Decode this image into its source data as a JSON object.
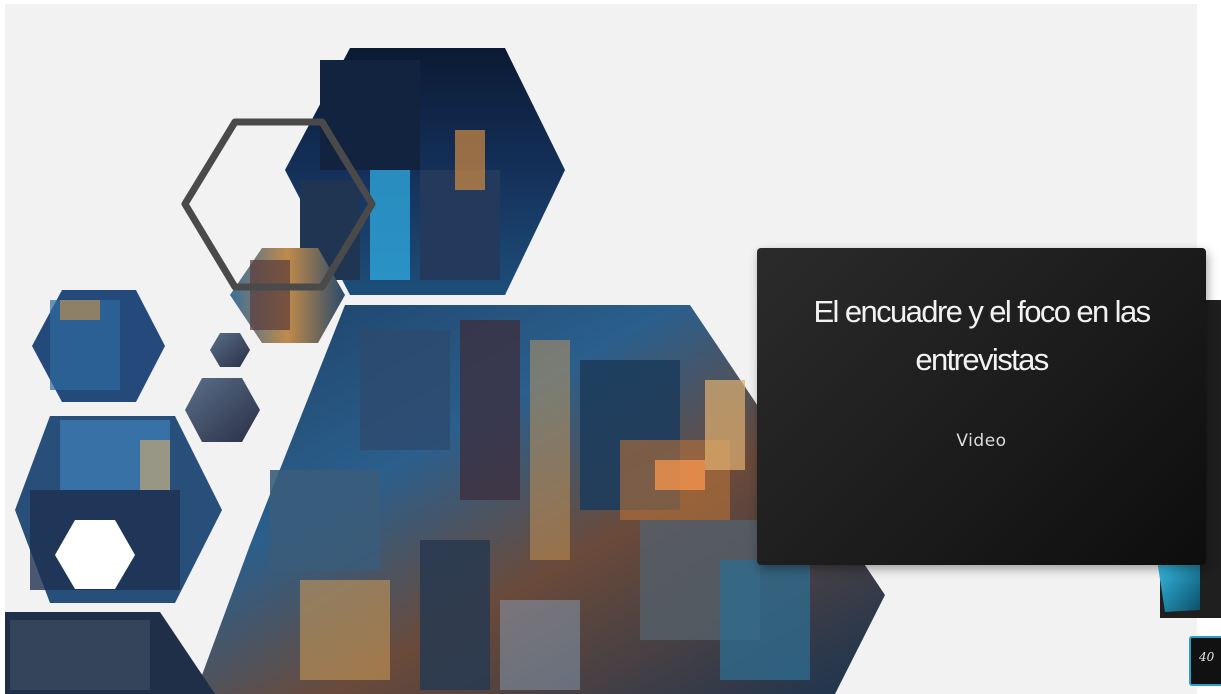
{
  "slide": {
    "title": "El encuadre y el foco en las entrevistas",
    "subtitle": "Video",
    "page_number": "40"
  },
  "image": {
    "description_name": "city-night-aerial-image"
  },
  "colors": {
    "card_background": "#1f1f1f",
    "accent": "#2aa0c8",
    "outline": "#444444",
    "slide_background": "#f2f2f2"
  }
}
